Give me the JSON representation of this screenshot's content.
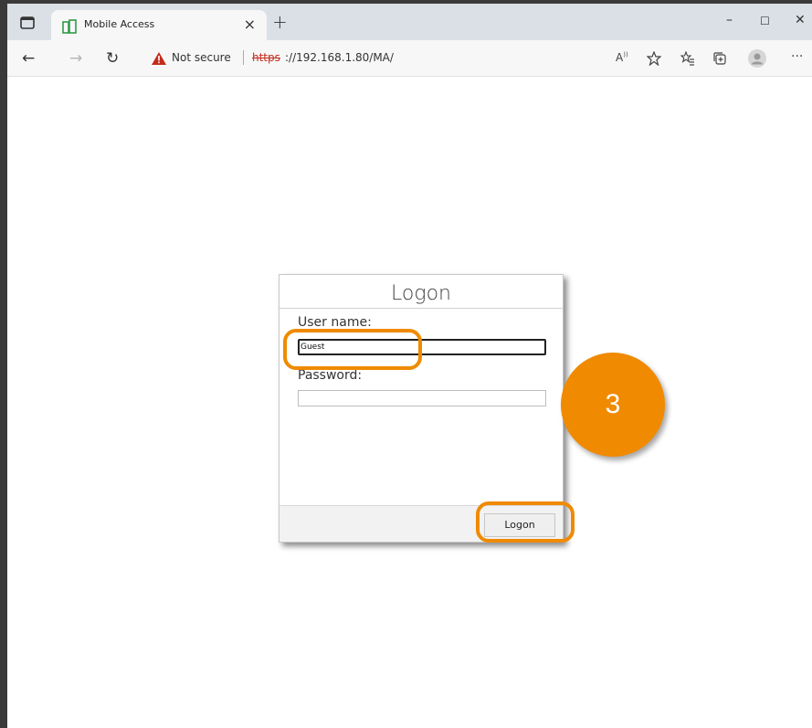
{
  "browser": {
    "tab_title": "Mobile Access",
    "tab_close": "×",
    "new_tab": "+",
    "window_controls": {
      "minimize": "–",
      "maximize": "☐",
      "close": "✕"
    },
    "nav": {
      "back": "←",
      "forward": "→",
      "refresh": "↻"
    },
    "security_label": "Not secure",
    "url_protocol": "https",
    "url_rest": "://192.168.1.80/MA/",
    "toolbar_icons": [
      "read-aloud-icon",
      "favorite-add-icon",
      "favorites-icon",
      "collections-icon",
      "profile-icon",
      "more-icon"
    ],
    "more_label": "···",
    "read_aloud_label": "A̅",
    "accent_warning": "#c42b1c"
  },
  "dialog": {
    "title": "Logon",
    "username_label": "User name:",
    "username_value": "Guest",
    "password_label": "Password:",
    "password_value": "",
    "submit_label": "Logon"
  },
  "annotation": {
    "step_number": "3",
    "highlight_color": "#f08a00"
  }
}
